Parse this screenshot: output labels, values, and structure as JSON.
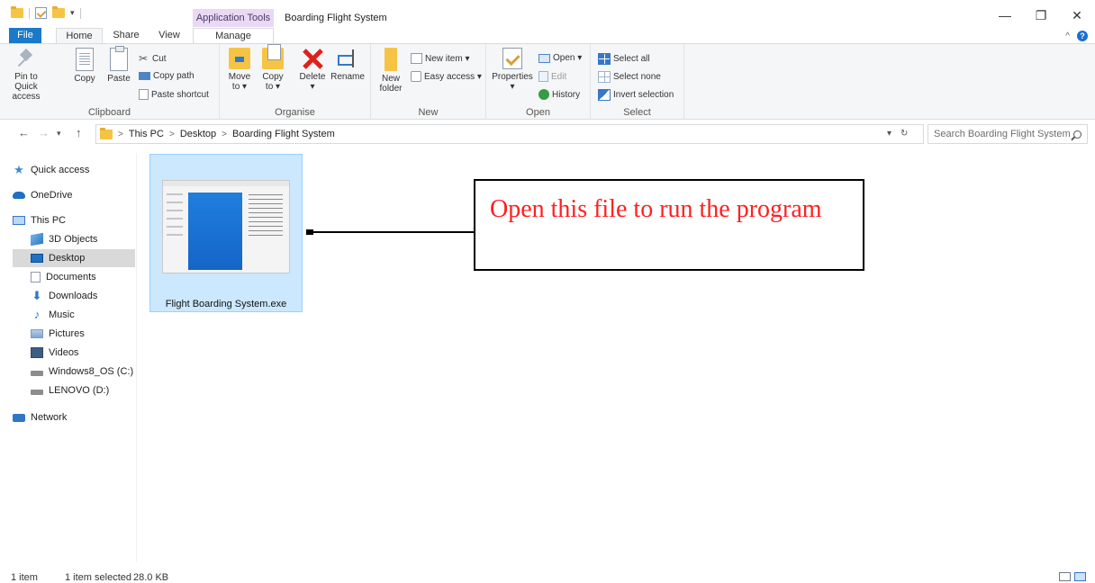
{
  "window": {
    "context_tab": "Application Tools",
    "title": "Boarding Flight System",
    "minimize_glyph": "—",
    "restore_glyph": "❐",
    "close_glyph": "✕"
  },
  "ribbon_tabs": {
    "file": "File",
    "home": "Home",
    "share": "Share",
    "view": "View",
    "manage": "Manage"
  },
  "ribbon": {
    "clipboard": {
      "label": "Clipboard",
      "pin_line1": "Pin to Quick",
      "pin_line2": "access",
      "copy": "Copy",
      "paste": "Paste",
      "cut": "Cut",
      "copy_path": "Copy path",
      "paste_shortcut": "Paste shortcut"
    },
    "organise": {
      "label": "Organise",
      "move_line1": "Move",
      "move_line2": "to ▾",
      "copy_line1": "Copy",
      "copy_line2": "to ▾",
      "delete": "Delete",
      "delete_arrow": "▾",
      "rename": "Rename"
    },
    "new": {
      "label": "New",
      "folder_line1": "New",
      "folder_line2": "folder",
      "new_item": "New item ▾",
      "easy_access": "Easy access ▾"
    },
    "open": {
      "label": "Open",
      "properties": "Properties",
      "properties_arrow": "▾",
      "open": "Open ▾",
      "edit": "Edit",
      "history": "History"
    },
    "select": {
      "label": "Select",
      "select_all": "Select all",
      "select_none": "Select none",
      "invert_selection": "Invert selection"
    }
  },
  "address": {
    "crumbs": [
      "This PC",
      "Desktop",
      "Boarding Flight System"
    ],
    "separator": ">",
    "search_placeholder": "Search Boarding Flight System"
  },
  "nav": {
    "quick_access": "Quick access",
    "onedrive": "OneDrive",
    "this_pc": "This PC",
    "objects_3d": "3D Objects",
    "desktop": "Desktop",
    "documents": "Documents",
    "downloads": "Downloads",
    "music": "Music",
    "pictures": "Pictures",
    "videos": "Videos",
    "drive_c": "Windows8_OS (C:)",
    "drive_d": "LENOVO (D:)",
    "network": "Network"
  },
  "content": {
    "file_name": "Flight Boarding System.exe",
    "annotation": "Open this file to run the program"
  },
  "status": {
    "count": "1 item",
    "selected": "1 item selected",
    "size": "28.0 KB"
  },
  "colors": {
    "accent": "#1979ca",
    "selection": "#cce8ff",
    "annotation_text": "#ff2020",
    "context_tab": "#e9d9f4"
  }
}
